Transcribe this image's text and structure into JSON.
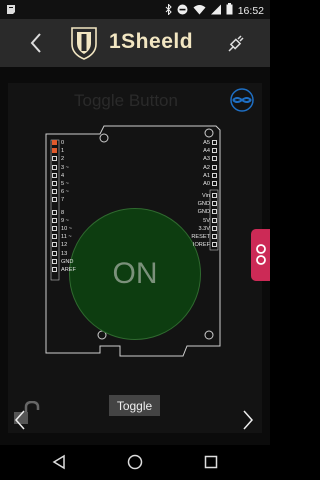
{
  "status": {
    "time": "16:52",
    "icons": [
      "notification-icon",
      "bluetooth-icon",
      "dnd-icon",
      "wifi-icon",
      "signal-icon",
      "battery-icon"
    ]
  },
  "app": {
    "title": "1Sheeld",
    "brand_color": "#f2e6c2"
  },
  "shield": {
    "title": "Toggle Button",
    "button_text": "ON",
    "button_color": "#0d3d10",
    "toggle_label": "Toggle"
  },
  "board": {
    "digital_pins": [
      {
        "label": "0",
        "active": true
      },
      {
        "label": "1",
        "active": true
      },
      {
        "label": "2",
        "active": false
      },
      {
        "label": "3 ~",
        "active": false
      },
      {
        "label": "4",
        "active": false
      },
      {
        "label": "5 ~",
        "active": false
      },
      {
        "label": "6 ~",
        "active": false
      },
      {
        "label": "7",
        "active": false
      },
      {
        "label": "8",
        "active": false
      },
      {
        "label": "9 ~",
        "active": false
      },
      {
        "label": "10 ~",
        "active": false
      },
      {
        "label": "11 ~",
        "active": false
      },
      {
        "label": "12",
        "active": false
      },
      {
        "label": "13",
        "active": false
      },
      {
        "label": "GND",
        "active": false
      },
      {
        "label": "AREF",
        "active": false
      }
    ],
    "analog_pins": [
      "A5",
      "A4",
      "A3",
      "A2",
      "A1",
      "A0"
    ],
    "power_pins": [
      "Vin",
      "GND",
      "GND",
      "5V",
      "3.3V",
      "RESET",
      "IOREF"
    ],
    "active_color": "#e05a2c"
  }
}
